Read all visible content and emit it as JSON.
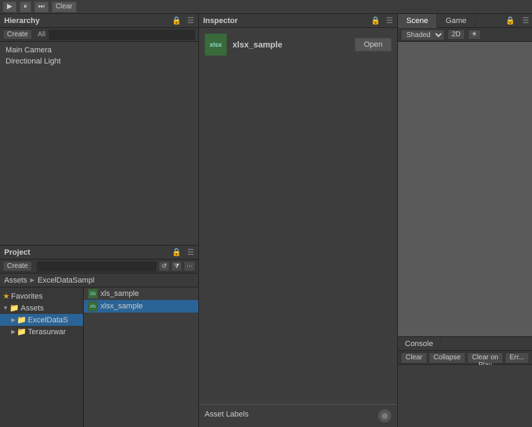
{
  "topToolbar": {
    "buttons": [
      "btn1",
      "btn2",
      "btn3",
      "btn4",
      "btn5",
      "Play",
      "Pause",
      "Step",
      "Clear"
    ]
  },
  "hierarchy": {
    "title": "Hierarchy",
    "createLabel": "Create",
    "searchPlaceholder": "",
    "allLabel": "All",
    "items": [
      {
        "label": "Main Camera"
      },
      {
        "label": "Directional Light"
      }
    ]
  },
  "project": {
    "title": "Project",
    "createLabel": "Create",
    "breadcrumb": {
      "assets": "Assets",
      "separator": "►",
      "folder": "ExcelDataSampl"
    },
    "tree": {
      "favorites": "Favorites",
      "assets": "Assets",
      "subfolders": [
        {
          "label": "ExcelDataS",
          "selected": true
        },
        {
          "label": "Terasurwar"
        }
      ]
    },
    "files": [
      {
        "name": "xls_sample",
        "type": "xls",
        "selected": false
      },
      {
        "name": "xlsx_sample",
        "type": "xls",
        "selected": true
      }
    ]
  },
  "inspector": {
    "title": "Inspector",
    "fileName": "xlsx_sample",
    "openButton": "Open",
    "assetLabels": "Asset Labels"
  },
  "scene": {
    "tabs": [
      {
        "label": "Scene",
        "active": true
      },
      {
        "label": "Game",
        "active": false
      }
    ],
    "shading": "Shaded",
    "mode2D": "2D"
  },
  "console": {
    "title": "Console",
    "buttons": {
      "clear": "Clear",
      "collapse": "Collapse",
      "clearOnPlay": "Clear on Play",
      "error": "Err..."
    }
  }
}
